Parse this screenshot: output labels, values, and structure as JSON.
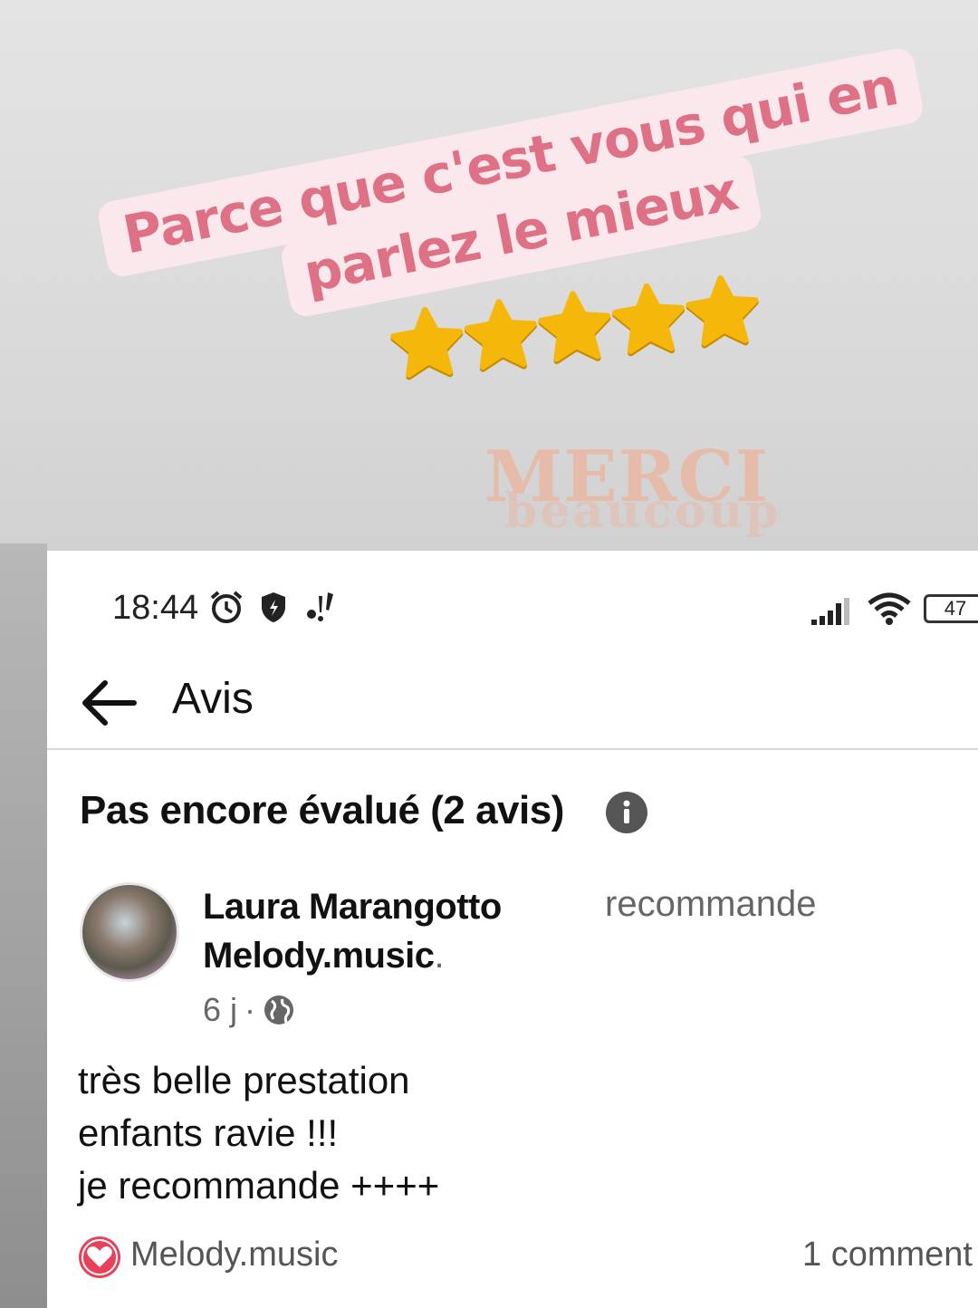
{
  "overlay": {
    "caption_line1": "Parce que c'est vous qui en",
    "caption_line2": "parlez le mieux",
    "rating": {
      "value": 5,
      "max": 5,
      "star_color": "#f5b70a"
    },
    "merci": "MERCI",
    "beaucoup": "beaucoup",
    "caption_color": "#df7186",
    "caption_bg": "#fbe8ec"
  },
  "status_bar": {
    "time": "18:44",
    "icons": [
      "alarm-icon",
      "shield-icon",
      "notification-icon",
      "signal-icon",
      "wifi-icon",
      "battery-icon"
    ],
    "battery": "47"
  },
  "header": {
    "back_icon": "arrow-left-icon",
    "title": "Avis"
  },
  "reviews": {
    "heading": "Pas encore évalué (2 avis)",
    "items": [
      {
        "author_line1": "Laura Marangotto",
        "author_line2": "Melody.music",
        "author_suffix": ".",
        "action": "recommande",
        "age": "6 j",
        "separator": "·",
        "visibility_icon": "globe-icon",
        "text_lines": [
          "très belle prestation",
          "enfants ravie !!!",
          "je recommande ++++"
        ],
        "reaction_icon": "heart-icon",
        "reaction_by": "Melody.music",
        "comments": "1 comment"
      }
    ]
  }
}
